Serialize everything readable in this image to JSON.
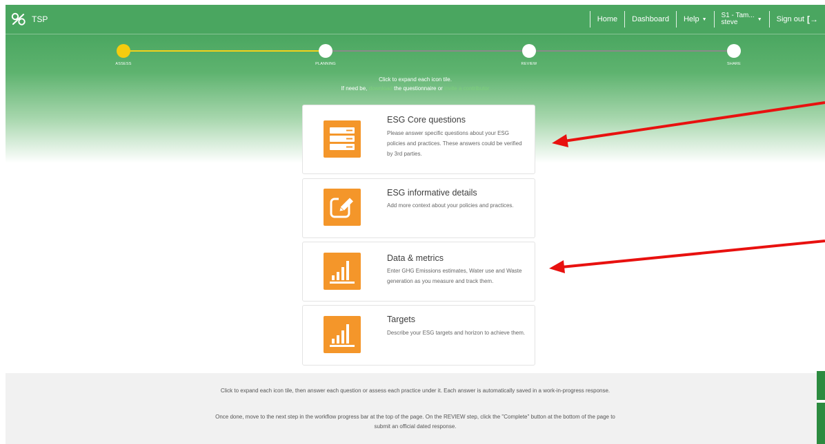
{
  "app": {
    "name": "TSP",
    "logo_icon": "tsp-logo-icon"
  },
  "nav": {
    "home": "Home",
    "dashboard": "Dashboard",
    "help": "Help",
    "user_line1": "S1 - Tam...",
    "user_line2": "steve",
    "signout": "Sign out"
  },
  "workflow": {
    "steps": [
      {
        "label": "ASSESS",
        "state": "active"
      },
      {
        "label": "PLANNING",
        "state": "pending"
      },
      {
        "label": "REVIEW",
        "state": "pending"
      },
      {
        "label": "SHARE",
        "state": "pending"
      }
    ],
    "active_color": "#f5cc0f"
  },
  "intro": {
    "line1": "Click to expand each icon tile.",
    "line2_pre": "If need be,",
    "download_link": "download",
    "line2_mid": "the questionnaire or",
    "invite_link": "invite a contributor"
  },
  "tiles": [
    {
      "title": "ESG Core questions",
      "description": "Please answer specific questions about your ESG policies and practices. These answers could be verified by 3rd parties.",
      "icon": "server-list-icon"
    },
    {
      "title": "ESG informative details",
      "description": "Add more context about your policies and practices.",
      "icon": "edit-icon"
    },
    {
      "title": "Data & metrics",
      "description": "Enter GHG Emissions estimates, Water use and Waste generation as you measure and track them.",
      "icon": "bar-chart-icon"
    },
    {
      "title": "Targets",
      "description": "Describe your ESG targets and horizon to achieve them.",
      "icon": "bar-chart-icon"
    }
  ],
  "footer": {
    "para1": "Click to expand each icon tile, then answer each question or assess each practice under it. Each answer is automatically saved in a work-in-progress response.",
    "para2": "Once done, move to the next step in the workflow progress bar at the top of the page. On the REVIEW step, click the \"Complete\" button at the bottom of the page to submit an official dated response."
  },
  "colors": {
    "header_green": "#4aa660",
    "tile_orange": "#f4962a",
    "annotation_red": "#e8110f",
    "side_tab_green": "#2c8b40"
  }
}
